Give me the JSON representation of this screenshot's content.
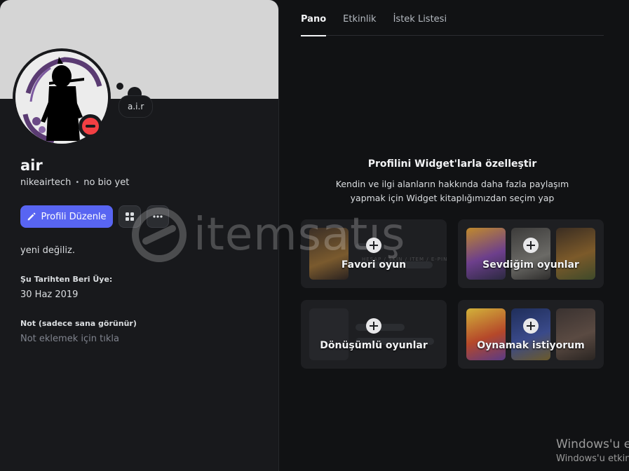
{
  "profile": {
    "display_name": "air",
    "username": "nikeairtech",
    "bio": "no bio yet",
    "custom_status": "a.i.r",
    "status": "dnd",
    "edit_button_label": "Profili Düzenle",
    "about_text": "yeni değiliz.",
    "member_since_label": "Şu Tarihten Beri Üye:",
    "member_since_date": "30 Haz 2019",
    "note_label": "Not (sadece sana görünür)",
    "note_placeholder": "Not eklemek için tıkla"
  },
  "tabs": [
    {
      "label": "Pano",
      "active": true
    },
    {
      "label": "Etkinlik",
      "active": false
    },
    {
      "label": "İstek Listesi",
      "active": false
    }
  ],
  "promo": {
    "title": "Profilini Widget'larla özelleştir",
    "line1": "Kendin ve ilgi alanların hakkında daha fazla paylaşım",
    "line2": "yapmak için Widget kitaplığımızdan seçim yap"
  },
  "widgets": [
    {
      "label": "Favori oyun"
    },
    {
      "label": "Sevdiğim oyunlar"
    },
    {
      "label": "Dönüşümlü oyunlar"
    },
    {
      "label": "Oynamak istiyorum"
    }
  ],
  "watermark": {
    "text": "itemsatış",
    "sub": "HESAP / SKIN / ITEM / E-PIN"
  },
  "windows_activation": {
    "line1": "Windows'u e",
    "line2": "Windows'u etkin"
  },
  "colors": {
    "accent": "#5865f2",
    "dnd": "#f23f43",
    "banner": "#d5d5d5",
    "panel": "#18191c",
    "background": "#111214"
  }
}
